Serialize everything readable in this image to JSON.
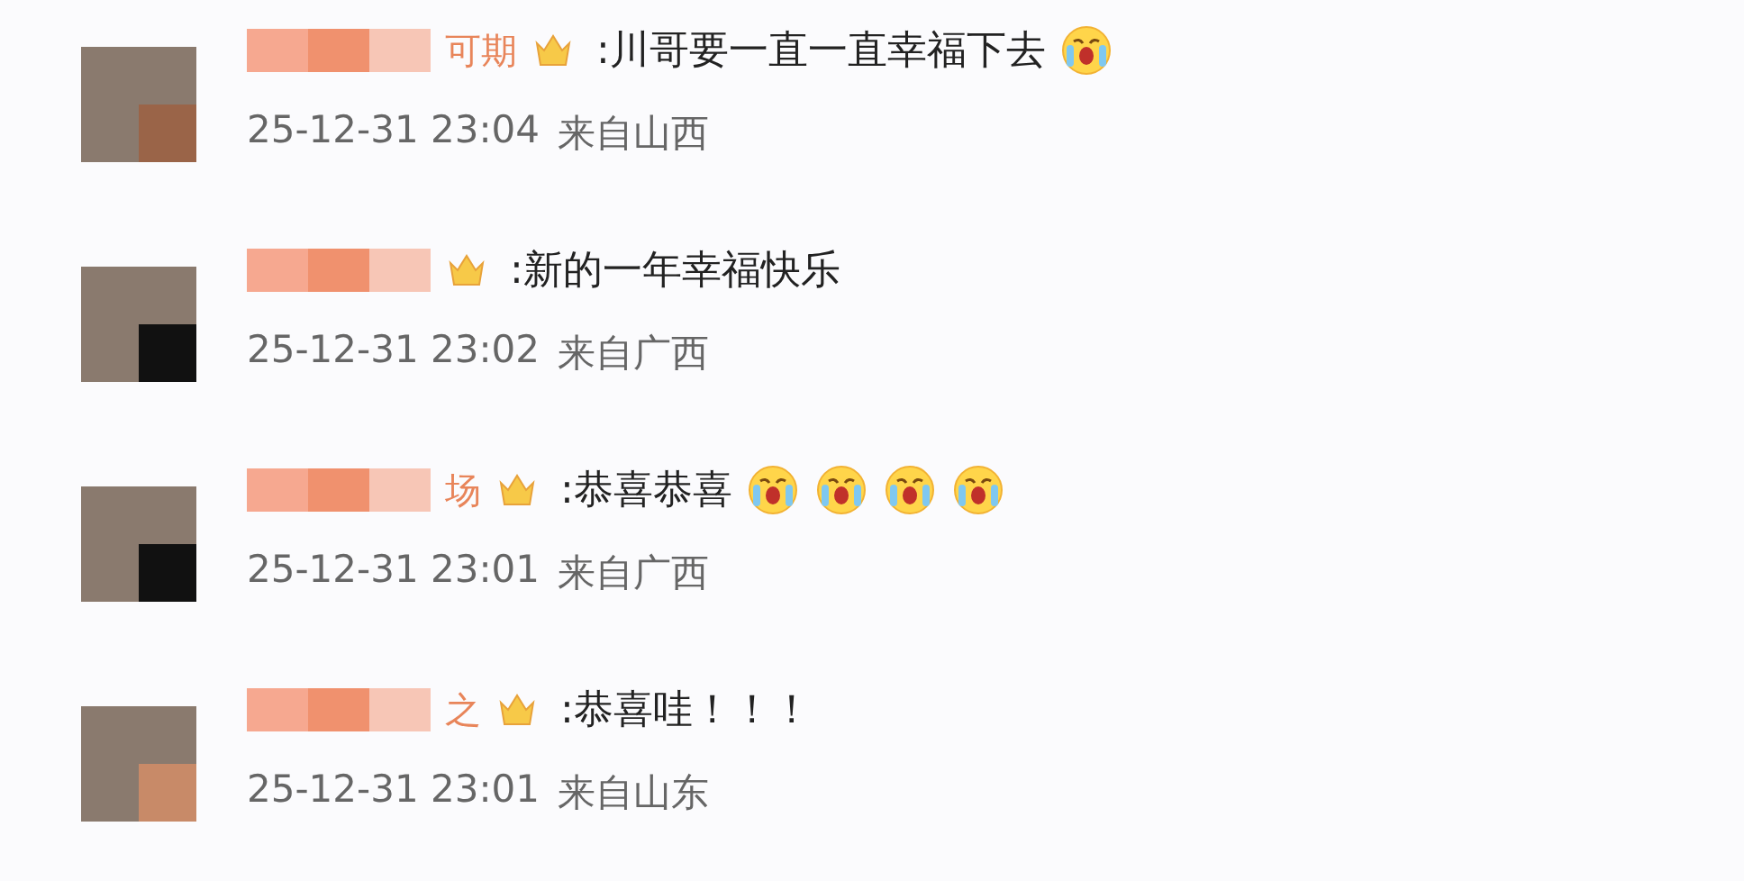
{
  "comments": [
    {
      "name_fragment": "可期",
      "text": ":川哥要一直一直幸福下去",
      "emojis": [
        {
          "kind": "crying-face"
        }
      ],
      "time": "25-12-31 23:04",
      "location": "来自山西"
    },
    {
      "text": ":新的一年幸福快乐",
      "time": "25-12-31 23:02",
      "location": "来自广西"
    },
    {
      "name_fragment": "场",
      "text": ":恭喜恭喜",
      "emojis": [
        {
          "kind": "crying-face"
        },
        {
          "kind": "crying-face"
        },
        {
          "kind": "crying-face"
        },
        {
          "kind": "crying-face"
        }
      ],
      "time": "25-12-31 23:01",
      "location": "来自广西"
    },
    {
      "name_fragment": "之",
      "text": ":恭喜哇！！！",
      "time": "25-12-31 23:01",
      "location": "来自山东"
    }
  ]
}
